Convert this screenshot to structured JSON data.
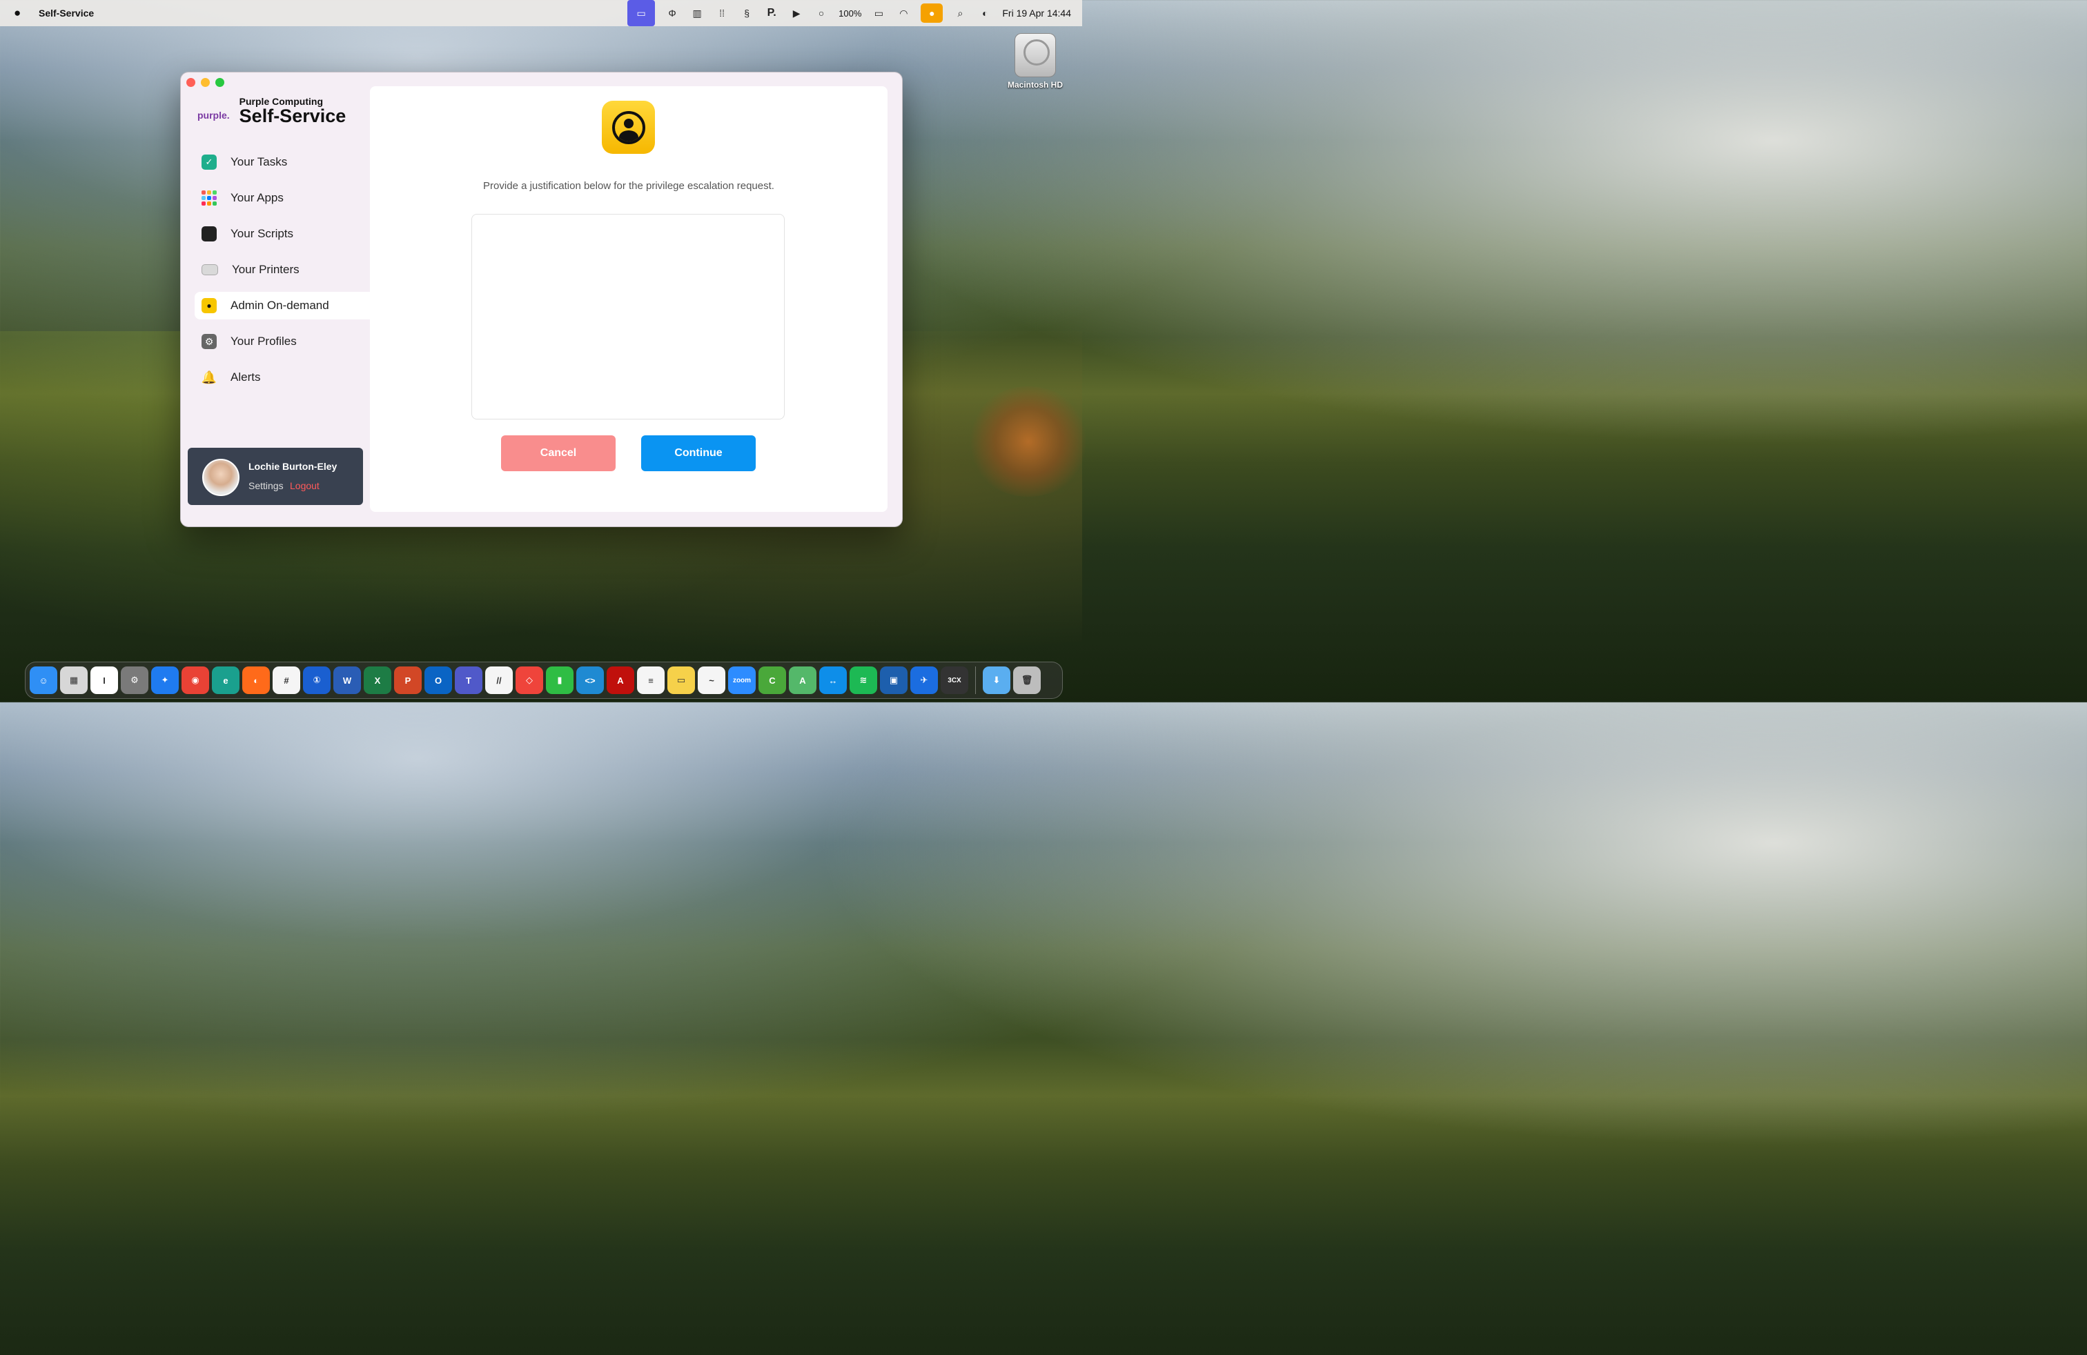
{
  "menubar": {
    "app_name": "Self-Service",
    "battery": "100%",
    "clock": "Fri 19 Apr  14:44"
  },
  "desktop": {
    "disk_label": "Macintosh HD"
  },
  "window": {
    "brand_logo": "purple.",
    "org_name": "Purple Computing",
    "app_title": "Self-Service",
    "nav": [
      {
        "label": "Your Tasks",
        "icon": "checkbox-icon"
      },
      {
        "label": "Your Apps",
        "icon": "apps-grid-icon"
      },
      {
        "label": "Your Scripts",
        "icon": "terminal-icon"
      },
      {
        "label": "Your Printers",
        "icon": "printer-icon"
      },
      {
        "label": "Admin On-demand",
        "icon": "admin-user-icon",
        "active": true
      },
      {
        "label": "Your Profiles",
        "icon": "gear-profile-icon"
      },
      {
        "label": "Alerts",
        "icon": "bell-icon"
      }
    ],
    "user": {
      "name": "Lochie Burton-Eley",
      "settings": "Settings",
      "logout": "Logout"
    },
    "content": {
      "prompt": "Provide a justification below for the privilege escalation request.",
      "justification_value": "",
      "cancel_label": "Cancel",
      "continue_label": "Continue"
    }
  },
  "colors": {
    "accent_blue": "#0a94f2",
    "cancel_red": "#f98d8d",
    "user_card": "#394150",
    "logout_red": "#ff5a5a"
  },
  "dock": [
    {
      "name": "finder-icon",
      "glyph": "☺",
      "color": "#2f8ff5"
    },
    {
      "name": "launchpad-icon",
      "glyph": "▦",
      "color": "#d7d7d7"
    },
    {
      "name": "app-icon",
      "glyph": "I",
      "color": "#ffffff"
    },
    {
      "name": "system-settings-icon",
      "glyph": "⚙",
      "color": "#7a7a7a"
    },
    {
      "name": "safari-icon",
      "glyph": "✦",
      "color": "#1f7bf0"
    },
    {
      "name": "chrome-icon",
      "glyph": "◉",
      "color": "#e94235"
    },
    {
      "name": "edge-icon",
      "glyph": "e",
      "color": "#1aa08e"
    },
    {
      "name": "firefox-icon",
      "glyph": "◐",
      "color": "#ff6a1a"
    },
    {
      "name": "slack-icon",
      "glyph": "#",
      "color": "#f5f5f5"
    },
    {
      "name": "1password-icon",
      "glyph": "①",
      "color": "#1a5fd0"
    },
    {
      "name": "word-icon",
      "glyph": "W",
      "color": "#2a5db5"
    },
    {
      "name": "excel-icon",
      "glyph": "X",
      "color": "#1d7c45"
    },
    {
      "name": "powerpoint-icon",
      "glyph": "P",
      "color": "#d24726"
    },
    {
      "name": "outlook-icon",
      "glyph": "O",
      "color": "#0a64c4"
    },
    {
      "name": "teams-icon",
      "glyph": "T",
      "color": "#5059c9"
    },
    {
      "name": "monday-icon",
      "glyph": "//",
      "color": "#f5f5f5"
    },
    {
      "name": "anydesk-icon",
      "glyph": "◇",
      "color": "#ef443b"
    },
    {
      "name": "numbers-icon",
      "glyph": "▮",
      "color": "#2fbd44"
    },
    {
      "name": "vscode-icon",
      "glyph": "<>",
      "color": "#1f8ad2"
    },
    {
      "name": "acrobat-icon",
      "glyph": "A",
      "color": "#c0100c"
    },
    {
      "name": "reminders-icon",
      "glyph": "≡",
      "color": "#f5f5f5"
    },
    {
      "name": "notes-icon",
      "glyph": "▭",
      "color": "#f6d14a"
    },
    {
      "name": "freeform-icon",
      "glyph": "~",
      "color": "#f5f5f5"
    },
    {
      "name": "zoom-icon",
      "glyph": "zoom",
      "color": "#2d8cff"
    },
    {
      "name": "cursor-icon",
      "glyph": "C",
      "color": "#4aa83a"
    },
    {
      "name": "maps-icon",
      "glyph": "A",
      "color": "#54b86a"
    },
    {
      "name": "teamviewer-icon",
      "glyph": "↔",
      "color": "#0e8ee9"
    },
    {
      "name": "spotify-icon",
      "glyph": "≋",
      "color": "#1db954"
    },
    {
      "name": "remote-desktop-icon",
      "glyph": "▣",
      "color": "#1d5fad"
    },
    {
      "name": "testflight-icon",
      "glyph": "✈",
      "color": "#1b6de0"
    },
    {
      "name": "3cx-icon",
      "glyph": "3CX",
      "color": "#333333"
    },
    {
      "name": "downloads-folder-icon",
      "glyph": "⬇",
      "color": "#5aaef0"
    },
    {
      "name": "trash-icon",
      "glyph": "🗑",
      "color": "#bdbdbd"
    }
  ]
}
